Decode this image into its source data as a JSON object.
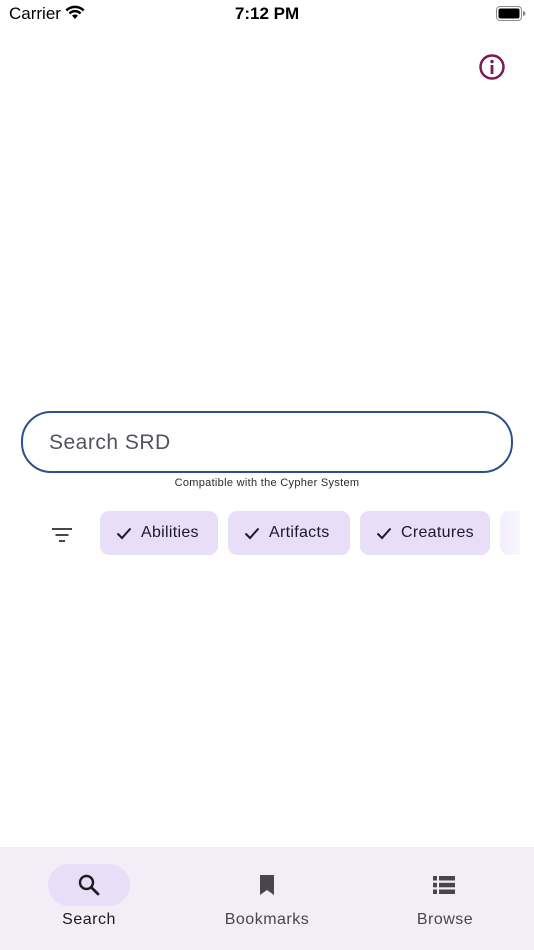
{
  "status_bar": {
    "carrier": "Carrier",
    "time": "7:12 PM"
  },
  "header": {
    "info_icon": "info-icon",
    "accent_color": "#7d1a55"
  },
  "search": {
    "placeholder": "Search SRD",
    "value": "",
    "tagline": "Compatible with the Cypher System",
    "border_color": "#2d4f8c"
  },
  "filters": {
    "icon": "filter-icon",
    "chips": [
      {
        "label": "Abilities",
        "selected": true
      },
      {
        "label": "Artifacts",
        "selected": true
      },
      {
        "label": "Creatures",
        "selected": true
      }
    ],
    "chip_color": "#e8def8"
  },
  "bottom_nav": {
    "items": [
      {
        "label": "Search",
        "icon": "search-icon",
        "active": true
      },
      {
        "label": "Bookmarks",
        "icon": "bookmark-icon",
        "active": false
      },
      {
        "label": "Browse",
        "icon": "list-icon",
        "active": false
      }
    ],
    "background": "#f3edf7"
  }
}
